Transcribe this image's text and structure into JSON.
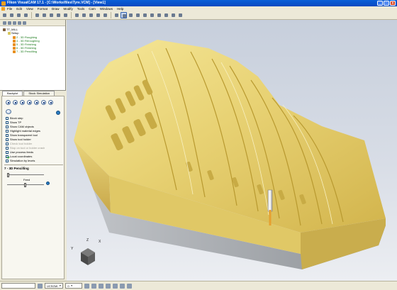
{
  "window": {
    "title": "Flkon VisualCAM 17.1 - [C:\\Works\\files\\Tyre.VCM] - [View1]",
    "buttons": [
      "_",
      "□",
      "×"
    ]
  },
  "menu": [
    "File",
    "Edit",
    "View",
    "Format",
    "Draw",
    "Modify",
    "Tools",
    "Cam",
    "Windows",
    "Help"
  ],
  "toolbar": {
    "icons": [
      "new-icon",
      "open-icon",
      "save-icon",
      "print-icon",
      "cut-icon",
      "copy-icon",
      "paste-icon",
      "undo-icon",
      "redo-icon",
      "snap-icon",
      "select-icon",
      "machine-icon",
      "zoom-icon",
      "rotate-icon",
      "pan-icon",
      "shade-icon",
      "wireframe-icon",
      "fit-icon",
      "view-iso-icon",
      "view-front-icon",
      "view-top-icon",
      "view-right-icon",
      "render-icon",
      "settings-icon"
    ],
    "selected_icon": "shade-icon"
  },
  "tree": {
    "root": "TT_MILL",
    "setup": "Setup",
    "operations": [
      "2 - 3D Roughing",
      "4 - 3D Reroughing",
      "5 - 3D Finishing",
      "6 - 3D Finishing",
      "7 - 3D Pencilling"
    ]
  },
  "tabs": [
    "Backplot",
    "Stock Simulation"
  ],
  "options": [
    {
      "label": "Block step",
      "checked": false,
      "enabled": true
    },
    {
      "label": "Show TP",
      "checked": false,
      "enabled": true
    },
    {
      "label": "Show CAM objects",
      "checked": false,
      "enabled": true
    },
    {
      "label": "Highlight material edges",
      "checked": false,
      "enabled": true
    },
    {
      "label": "Show transparent tool",
      "checked": false,
      "enabled": true
    },
    {
      "label": "Show tool holder",
      "checked": false,
      "enabled": true
    },
    {
      "label": "Check tool holder",
      "checked": false,
      "enabled": false
    },
    {
      "label": "Stop on tool or holder crash",
      "checked": false,
      "enabled": false
    },
    {
      "label": "Use process feeds",
      "checked": false,
      "enabled": true
    },
    {
      "label": "Local coordinates",
      "checked": true,
      "enabled": true
    },
    {
      "label": "Simulation by levels",
      "checked": false,
      "enabled": true
    }
  ],
  "operation_title": "7 - 3D Pencilling",
  "feed": {
    "label": "Feed"
  },
  "axis_labels": {
    "x": "X",
    "y": "Y",
    "z": "Z"
  },
  "status": {
    "coord_label": "UCSGW",
    "value": "0",
    "icons": [
      "snap-grid-icon",
      "ortho-icon",
      "osnap-icon",
      "polar-icon",
      "layer-icon",
      "color-icon",
      "linetype-icon"
    ]
  },
  "colors": {
    "model": "#e3cf6e",
    "model_top": "#f2e38f",
    "model_shadow": "#b59a33",
    "viewport_bg": "#d0d6e0"
  }
}
